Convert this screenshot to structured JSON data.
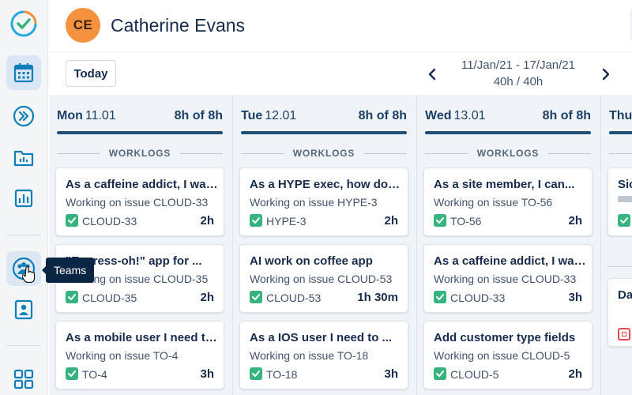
{
  "sidebar": {
    "tooltip": "Teams",
    "icons": [
      "tempo-logo-icon",
      "calendar-icon",
      "chevrons-right-icon",
      "folder-chart-icon",
      "bar-chart-icon",
      "teams-icon",
      "user-card-icon",
      "grid-apps-icon"
    ]
  },
  "user": {
    "initials": "CE",
    "name": "Catherine Evans"
  },
  "toolbar": {
    "today_label": "Today",
    "range": "11/Jan/21 - 17/Jan/21",
    "hours": "40h / 40h"
  },
  "section_label": "WORKLOGS",
  "days": [
    {
      "day": "Mon",
      "date": "11.01",
      "hours": "8h of 8h",
      "cards": [
        {
          "title": "As a caffeine addict, I want to...",
          "subtitle": "Working on issue CLOUD-33",
          "key": "CLOUD-33",
          "duration": "2h"
        },
        {
          "title": "\"Express-oh!\" app for ...",
          "subtitle": "Working on issue CLOUD-35",
          "key": "CLOUD-35",
          "duration": "2h"
        },
        {
          "title": "As a mobile user I need to...",
          "subtitle": "Working on issue TO-4",
          "key": "TO-4",
          "duration": "3h"
        }
      ]
    },
    {
      "day": "Tue",
      "date": "12.01",
      "hours": "8h of 8h",
      "cards": [
        {
          "title": "As a HYPE exec, how do I...",
          "subtitle": "Working on issue HYPE-3",
          "key": "HYPE-3",
          "duration": "2h"
        },
        {
          "title": "AI work on coffee app",
          "subtitle": "Working on issue CLOUD-53",
          "key": "CLOUD-53",
          "duration": "1h 30m"
        },
        {
          "title": "As a IOS user I need to ...",
          "subtitle": "Working on issue TO-18",
          "key": "TO-18",
          "duration": "3h"
        }
      ]
    },
    {
      "day": "Wed",
      "date": "13.01",
      "hours": "8h of 8h",
      "cards": [
        {
          "title": "As a site member, I can...",
          "subtitle": "Working on issue TO-56",
          "key": "TO-56",
          "duration": "2h"
        },
        {
          "title": "As a caffeine addict, I want to...",
          "subtitle": "Working on issue CLOUD-33",
          "key": "CLOUD-33",
          "duration": "3h"
        },
        {
          "title": "Add customer type fields",
          "subtitle": "Working on issue CLOUD-5",
          "key": "CLOUD-5",
          "duration": "2h"
        }
      ]
    },
    {
      "day": "Thu",
      "cards": [
        {
          "title": "Sic"
        },
        {
          "title": "Da"
        }
      ]
    }
  ],
  "colors": {
    "accent": "#1c4f7a",
    "avatar": "#f6923e",
    "check": "#36b37e",
    "tooltip": "#0b2545"
  }
}
